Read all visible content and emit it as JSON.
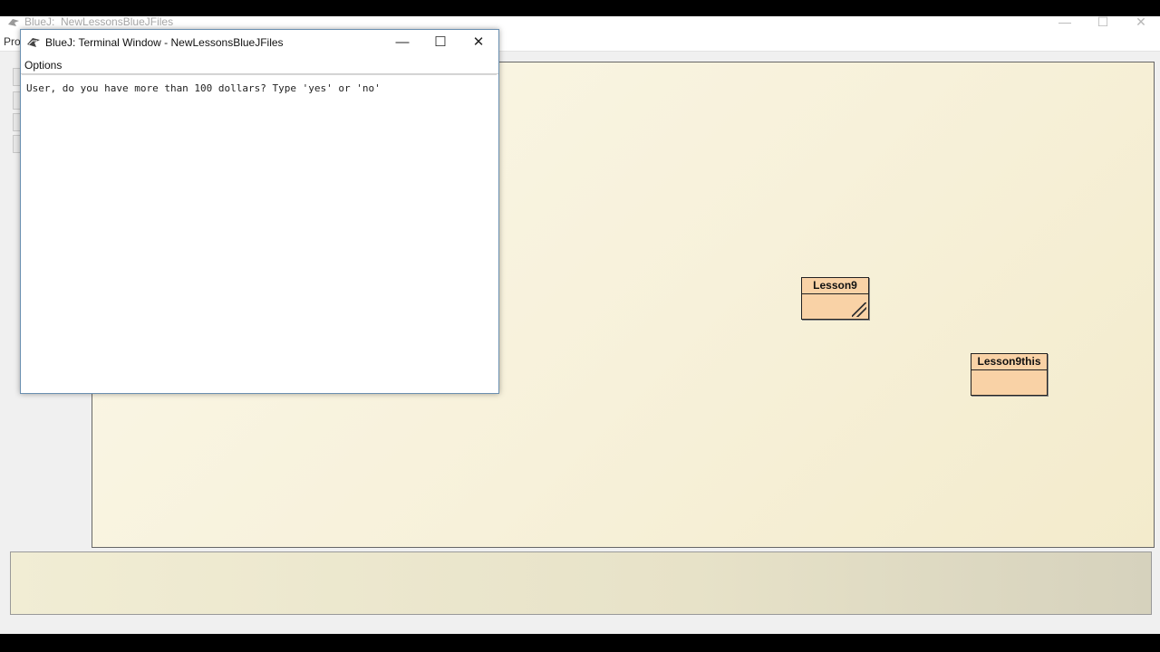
{
  "main_window": {
    "title": "BlueJ:  NewLessonsBlueJFiles",
    "menu_visible": "Pro",
    "controls": {
      "minimize": "—",
      "maximize": "☐",
      "close": "✕"
    }
  },
  "diagram": {
    "classes": [
      {
        "name": "Lesson9",
        "needs_compile": true
      },
      {
        "name": "Lesson9this",
        "needs_compile": false
      }
    ]
  },
  "terminal": {
    "title": "BlueJ: Terminal Window - NewLessonsBlueJFiles",
    "menu": {
      "options_label": "Options"
    },
    "controls": {
      "minimize": "—",
      "maximize": "☐",
      "close": "✕"
    },
    "output_lines": [
      "User, do you have more than 100 dollars? Type 'yes' or 'no'"
    ]
  },
  "colors": {
    "class_fill": "#f9d2a6",
    "progress_stripe": "#c0392b"
  }
}
